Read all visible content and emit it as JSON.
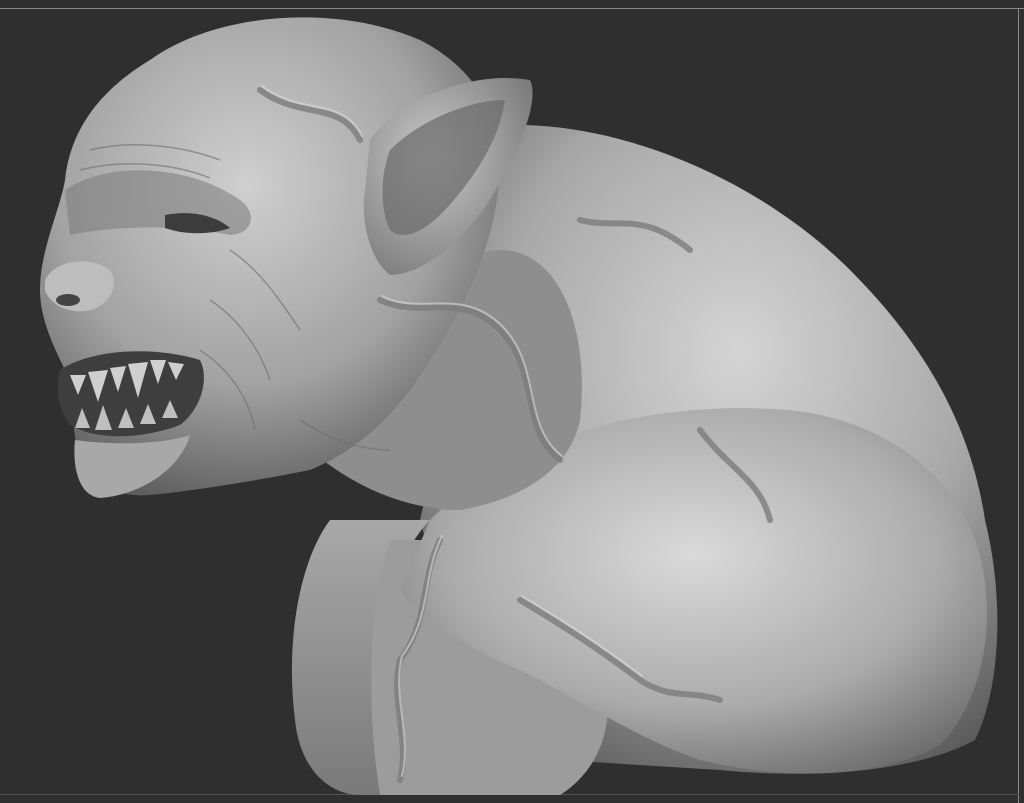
{
  "viewport": {
    "background_color": "#2f2f2f",
    "frame_color": "#8a8a8a",
    "model": "sculpted-creature-bust",
    "material_color": "#9a9a9a",
    "material_highlight": "#d9d9d9",
    "material_shadow": "#3c3c3c"
  }
}
